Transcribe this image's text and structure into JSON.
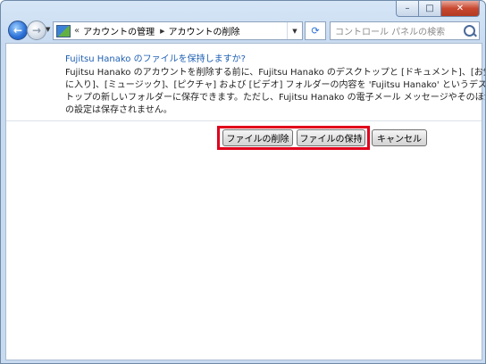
{
  "window": {
    "caption_buttons": {
      "minimize": "–",
      "maximize": "□",
      "close": "✕"
    }
  },
  "nav": {
    "back_icon": "back-arrow-icon",
    "forward_icon": "forward-arrow-icon",
    "address": {
      "prefix": "«",
      "breadcrumbs": [
        "アカウントの管理",
        "アカウントの削除"
      ],
      "separator": "▶"
    },
    "search_placeholder": "コントロール パネルの検索"
  },
  "dialog": {
    "question": "Fujitsu Hanako のファイルを保持しますか?",
    "paragraph_lines": [
      "Fujitsu Hanako のアカウントを削除する前に、Fujitsu Hanako のデスクトップと [ドキュメント]、[お気",
      "に入り]、[ミュージック]、[ピクチャ] および [ビデオ] フォルダーの内容を 'Fujitsu Hanako' というデスク",
      "トップの新しいフォルダーに保存できます。ただし、Fujitsu Hanako の電子メール メッセージやそのほか",
      "の設定は保存されません。"
    ],
    "buttons": {
      "delete_files": "ファイルの削除",
      "keep_files": "ファイルの保持",
      "cancel": "キャンセル"
    }
  },
  "colors": {
    "highlight": "#e0001b",
    "link_blue": "#1e5fb4",
    "titlebar": "#c7daf0"
  }
}
